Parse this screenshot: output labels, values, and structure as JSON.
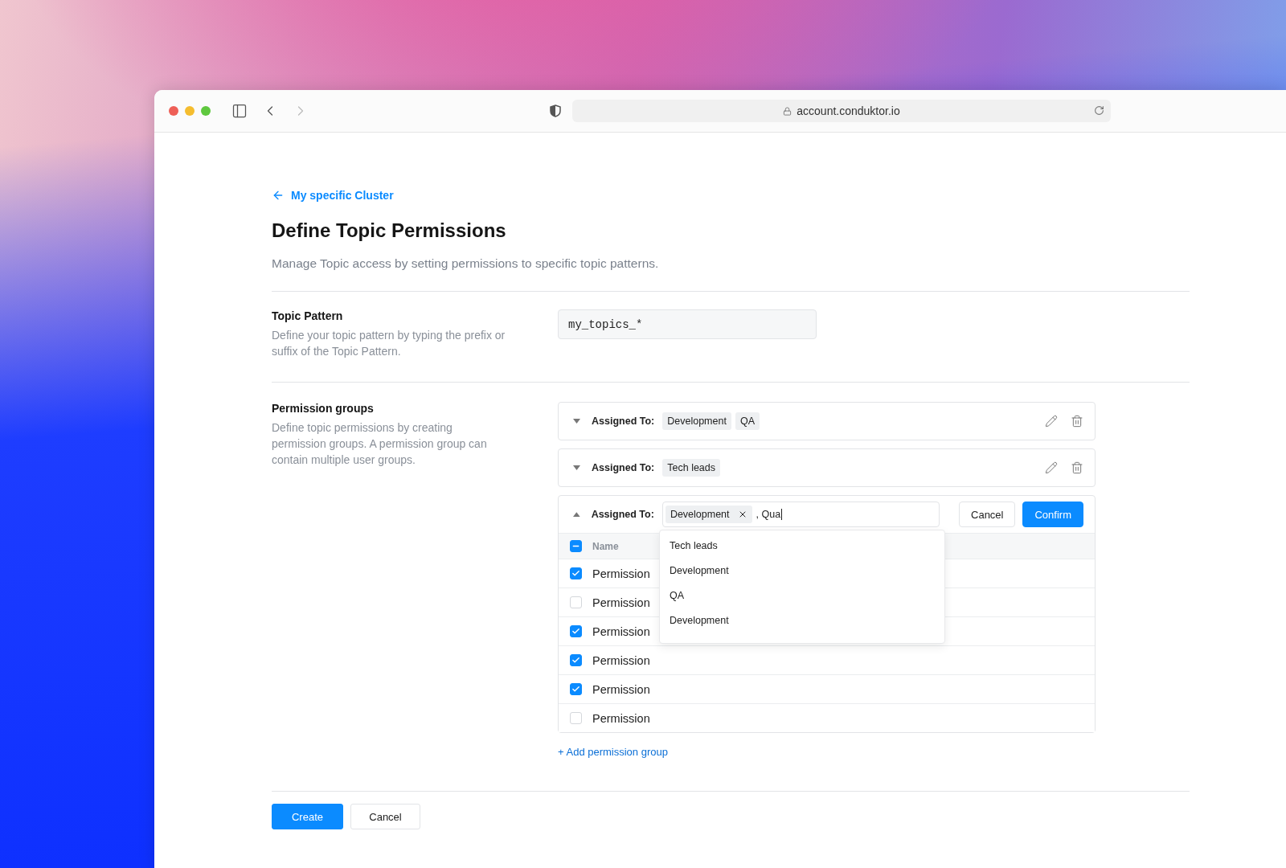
{
  "browser": {
    "url": "account.conduktor.io"
  },
  "back_link": "My specific Cluster",
  "title": "Define Topic Permissions",
  "subtitle": "Manage Topic access by setting permissions to specific topic patterns.",
  "topic_pattern": {
    "label": "Topic Pattern",
    "description": "Define your topic pattern by typing the prefix or suffix of the Topic Pattern.",
    "value": "my_topics_*"
  },
  "permission_groups": {
    "label": "Permission groups",
    "description": "Define topic permissions by creating permission groups. A permission group can contain multiple user groups.",
    "groups": [
      {
        "expanded": false,
        "label": "Assigned To:",
        "tags": [
          "Development",
          "QA"
        ]
      },
      {
        "expanded": false,
        "label": "Assigned To:",
        "tags": [
          "Tech leads"
        ]
      },
      {
        "expanded": true,
        "label": "Assigned To:",
        "tags": [
          "Development"
        ],
        "typed": ", Qua",
        "cancel": "Cancel",
        "confirm": "Confirm",
        "table": {
          "header": "Name",
          "header_indeterminate": true,
          "rows": [
            {
              "name": "Permission",
              "checked": true
            },
            {
              "name": "Permission",
              "checked": false
            },
            {
              "name": "Permission",
              "checked": true
            },
            {
              "name": "Permission",
              "checked": true
            },
            {
              "name": "Permission",
              "checked": true
            },
            {
              "name": "Permission",
              "checked": false
            }
          ]
        },
        "dropdown": [
          "Tech leads",
          "Development",
          "QA",
          "Development"
        ]
      }
    ],
    "add_button": "+ Add permission group"
  },
  "footer": {
    "create": "Create",
    "cancel": "Cancel"
  }
}
